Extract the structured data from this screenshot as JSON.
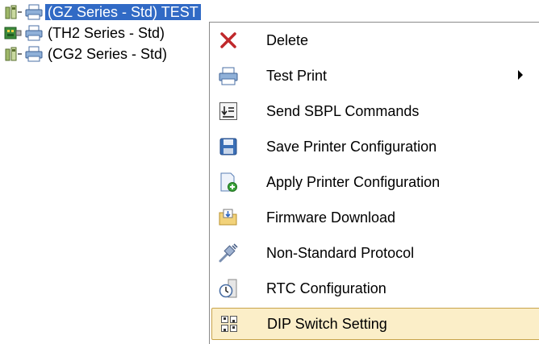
{
  "tree": {
    "items": [
      {
        "label": "(GZ Series - Std) TEST",
        "selected": true,
        "connection_icon": "usb-plug-icon",
        "printer_icon": "printer-icon"
      },
      {
        "label": "(TH2 Series - Std)",
        "selected": false,
        "connection_icon": "lan-card-icon",
        "printer_icon": "printer-icon"
      },
      {
        "label": "(CG2 Series - Std)",
        "selected": false,
        "connection_icon": "usb-plug-icon",
        "printer_icon": "printer-icon"
      }
    ]
  },
  "menu": {
    "items": [
      {
        "label": "Delete",
        "icon": "delete-x-icon"
      },
      {
        "label": "Test Print",
        "icon": "printer-icon",
        "has_submenu": true
      },
      {
        "label": "Send SBPL Commands",
        "icon": "commands-icon"
      },
      {
        "label": "Save Printer Configuration",
        "icon": "floppy-save-icon"
      },
      {
        "label": "Apply Printer Configuration",
        "icon": "apply-config-icon"
      },
      {
        "label": "Firmware Download",
        "icon": "folder-download-icon"
      },
      {
        "label": "Non-Standard Protocol",
        "icon": "cable-plug-icon"
      },
      {
        "label": "RTC Configuration",
        "icon": "clock-config-icon"
      },
      {
        "label": "DIP Switch Setting",
        "icon": "dip-switch-icon",
        "highlighted": true
      }
    ]
  },
  "colors": {
    "selection_bg": "#316ac5",
    "highlight_bg": "#fbeec8",
    "highlight_border": "#c8a34a"
  }
}
